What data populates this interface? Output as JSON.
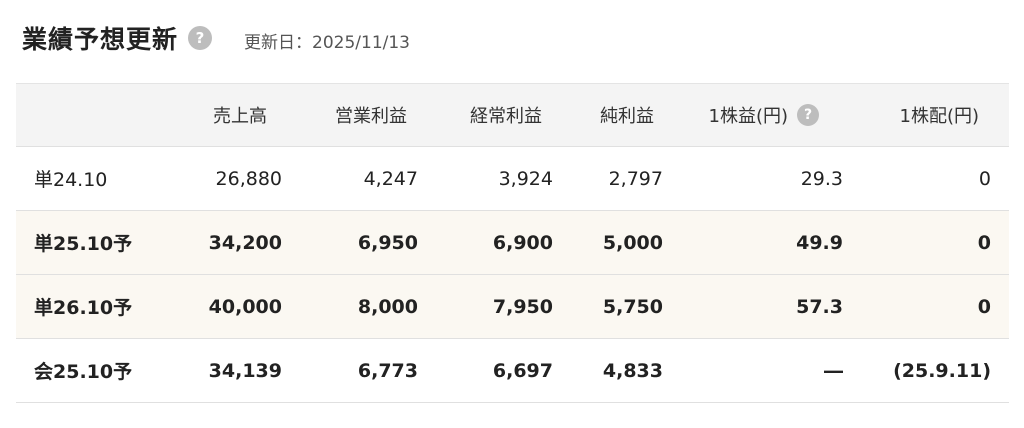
{
  "header": {
    "title": "業績予想更新",
    "help_icon": "?",
    "updated": "更新日：2025/11/13"
  },
  "table": {
    "columns": [
      "売上高",
      "営業利益",
      "経常利益",
      "純利益",
      "1株益(円)",
      "1株配(円)"
    ],
    "eps_help_icon": "?",
    "rows": [
      {
        "period": "単24.10",
        "values": [
          "26,880",
          "4,247",
          "3,924",
          "2,797",
          "29.3",
          "0"
        ]
      },
      {
        "period": "単25.10予",
        "values": [
          "34,200",
          "6,950",
          "6,900",
          "5,000",
          "49.9",
          "0"
        ]
      },
      {
        "period": "単26.10予",
        "values": [
          "40,000",
          "8,000",
          "7,950",
          "5,750",
          "57.3",
          "0"
        ]
      },
      {
        "period": "会25.10予",
        "values": [
          "34,139",
          "6,773",
          "6,697",
          "4,833",
          "―",
          "(25.9.11)"
        ]
      }
    ]
  },
  "colors": {
    "forecast_row_bg": "#fbf8f2",
    "header_bg": "#f4f4f4",
    "help_icon_bg": "#bdbdbd"
  }
}
